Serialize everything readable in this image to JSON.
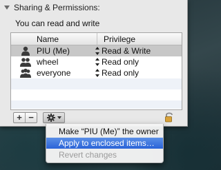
{
  "section": {
    "title": "Sharing & Permissions:"
  },
  "access_text": "You can read and write",
  "table": {
    "columns": [
      "Name",
      "Privilege"
    ],
    "rows": [
      {
        "name": "PIU (Me)",
        "privilege": "Read & Write",
        "icon": "single-user-icon",
        "selected": true
      },
      {
        "name": "wheel",
        "privilege": "Read only",
        "icon": "group-icon",
        "selected": false
      },
      {
        "name": "everyone",
        "privilege": "Read only",
        "icon": "everyone-icon",
        "selected": false
      }
    ]
  },
  "toolbar": {
    "add_label": "+",
    "remove_label": "−"
  },
  "context_menu": {
    "items": [
      {
        "label": "Make “PIU (Me)” the owner",
        "enabled": true,
        "highlighted": false
      },
      {
        "label": "Apply to enclosed items…",
        "enabled": true,
        "highlighted": true
      },
      {
        "label": "Revert changes",
        "enabled": false,
        "highlighted": false
      }
    ]
  },
  "colors": {
    "menu_highlight": "#3a73dc",
    "selected_row": "#c7c7c7",
    "lock": "#d9a23a"
  }
}
